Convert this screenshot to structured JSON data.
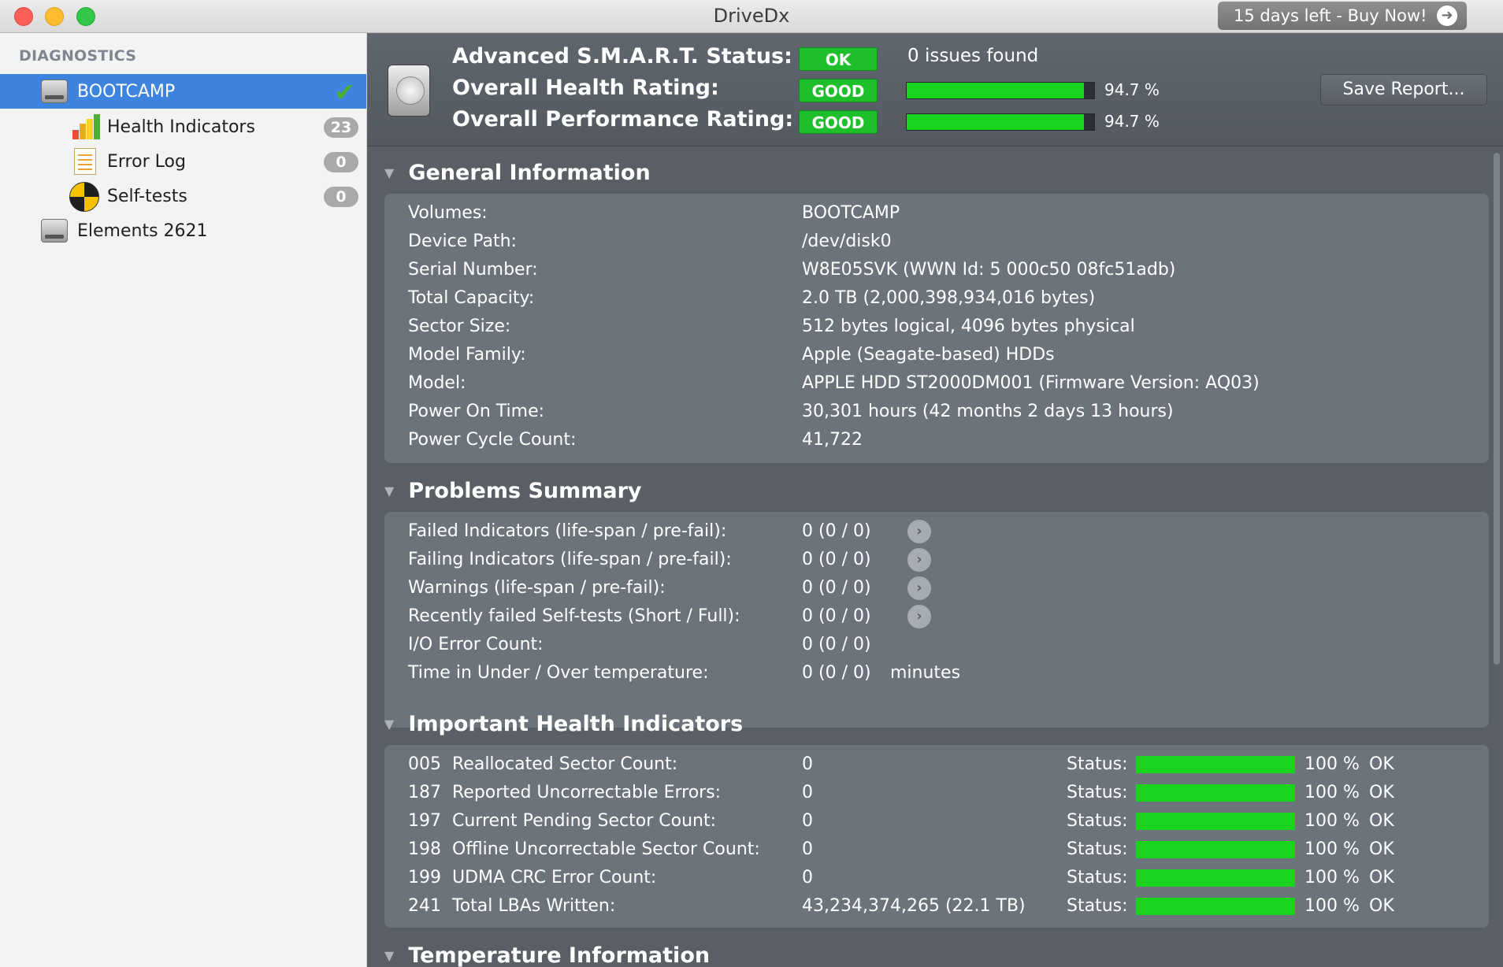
{
  "window": {
    "title": "DriveDx",
    "buy_label": "15 days left - Buy Now!"
  },
  "sidebar": {
    "header": "DIAGNOSTICS",
    "drives": [
      {
        "label": "BOOTCAMP",
        "selected": true
      },
      {
        "label": "Elements 2621",
        "selected": false
      }
    ],
    "subitems": [
      {
        "label": "Health Indicators",
        "badge": "23"
      },
      {
        "label": "Error Log",
        "badge": "0"
      },
      {
        "label": "Self-tests",
        "badge": "0"
      }
    ]
  },
  "status": {
    "smart_label": "Advanced S.M.A.R.T. Status:",
    "smart_value": "OK",
    "issues": "0 issues found",
    "health_label": "Overall Health Rating:",
    "health_value": "GOOD",
    "health_pct": "94.7 %",
    "health_fraction": 0.947,
    "perf_label": "Overall Performance Rating:",
    "perf_value": "GOOD",
    "perf_pct": "94.7 %",
    "perf_fraction": 0.947,
    "save_label": "Save Report..."
  },
  "general": {
    "title": "General Information",
    "rows": [
      {
        "label": "Volumes:",
        "value": "BOOTCAMP"
      },
      {
        "label": "Device Path:",
        "value": "/dev/disk0"
      },
      {
        "label": "Serial Number:",
        "value": "W8E05SVK (WWN Id: 5 000c50 08fc51adb)"
      },
      {
        "label": "Total Capacity:",
        "value": "2.0 TB (2,000,398,934,016 bytes)"
      },
      {
        "label": "Sector Size:",
        "value": "512 bytes logical, 4096 bytes physical"
      },
      {
        "label": "Model Family:",
        "value": "Apple (Seagate-based) HDDs"
      },
      {
        "label": "Model:",
        "value": "APPLE HDD ST2000DM001  (Firmware Version: AQ03)"
      },
      {
        "label": "Power On Time:",
        "value": "30,301 hours (42 months 2 days 13 hours)"
      },
      {
        "label": "Power Cycle Count:",
        "value": "41,722"
      }
    ]
  },
  "problems": {
    "title": "Problems Summary",
    "rows": [
      {
        "label": "Failed Indicators (life-span / pre-fail):",
        "value": "0  (0 / 0)"
      },
      {
        "label": "Failing Indicators (life-span / pre-fail):",
        "value": "0  (0 / 0)"
      },
      {
        "label": "Warnings (life-span / pre-fail):",
        "value": "0  (0 / 0)"
      },
      {
        "label": "Recently failed Self-tests (Short / Full):",
        "value": "0  (0 / 0)"
      },
      {
        "label": "I/O Error Count:",
        "value": "0  (0 / 0)"
      },
      {
        "label": "Time in Under / Over temperature:",
        "value": "0  (0 / 0)"
      }
    ],
    "minutes": "minutes"
  },
  "health": {
    "title": "Important Health Indicators",
    "status_label": "Status:",
    "rows": [
      {
        "id": "005",
        "name": "Reallocated Sector Count:",
        "value": "0",
        "pct": "100 %",
        "fraction": 1.0,
        "state": "OK"
      },
      {
        "id": "187",
        "name": "Reported Uncorrectable Errors:",
        "value": "0",
        "pct": "100 %",
        "fraction": 1.0,
        "state": "OK"
      },
      {
        "id": "197",
        "name": "Current Pending Sector Count:",
        "value": "0",
        "pct": "100 %",
        "fraction": 1.0,
        "state": "OK"
      },
      {
        "id": "198",
        "name": "Offline Uncorrectable Sector Count:",
        "value": "0",
        "pct": "100 %",
        "fraction": 1.0,
        "state": "OK"
      },
      {
        "id": "199",
        "name": "UDMA CRC Error Count:",
        "value": "0",
        "pct": "100 %",
        "fraction": 1.0,
        "state": "OK"
      },
      {
        "id": "241",
        "name": "Total LBAs Written:",
        "value": "43,234,374,265 (22.1 TB)",
        "pct": "100 %",
        "fraction": 1.0,
        "state": "OK"
      }
    ]
  },
  "temperature": {
    "title": "Temperature Information"
  }
}
